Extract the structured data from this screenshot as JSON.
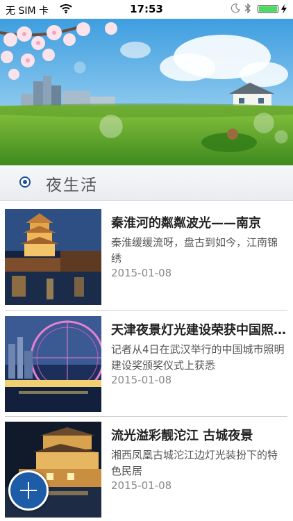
{
  "status_bar": {
    "carrier": "无 SIM 卡",
    "time": "17:53",
    "wifi_icon": "wifi-icon",
    "moon_icon": "moon-icon",
    "bluetooth_icon": "bluetooth-icon",
    "battery_icon": "battery-icon",
    "battery_color": "#4cd964"
  },
  "banner": {
    "image": "spring-city-park-illustration"
  },
  "section": {
    "title": "夜生活",
    "accent_color": "#1f4e9c"
  },
  "articles": [
    {
      "title": "秦淮河的粼粼波光——南京",
      "summary": "秦淮缓缓流呀，盘古到如今，江南锦绣",
      "date": "2015-01-08",
      "image": "nanjing-qinhuai-pagoda-night"
    },
    {
      "title": "天津夜景灯光建设荣获中国照明奖",
      "summary": "记者从4日在武汉举行的中国城市照明建设奖颁奖仪式上获悉",
      "date": "2015-01-08",
      "image": "tianjin-ferris-wheel-night"
    },
    {
      "title": "流光溢彩靓沱江 古城夜景",
      "summary": "湘西凤凰古城沱江边灯光装扮下的特色民居",
      "date": "2015-01-08",
      "image": "fenghuang-tuojiang-night"
    }
  ],
  "fab": {
    "icon": "plus-icon",
    "color": "#1f5ca8"
  }
}
